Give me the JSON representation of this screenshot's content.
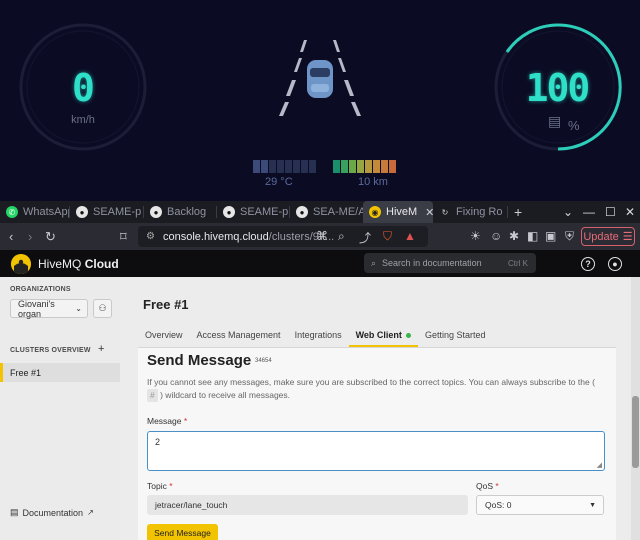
{
  "dashboard": {
    "speed": "0",
    "speed_unit": "km/h",
    "battery": "100",
    "battery_unit": "%",
    "temperature": "29 °C",
    "distance": "10 km",
    "colors": {
      "accent": "#2fe0c8",
      "background": "#0b0c24"
    }
  },
  "browser": {
    "tabs": [
      {
        "label": "WhatsApp",
        "icon": "whatsapp-icon"
      },
      {
        "label": "SEAME-p",
        "icon": "github-icon"
      },
      {
        "label": "Backlog",
        "icon": "github-icon"
      },
      {
        "label": "SEAME-p",
        "icon": "github-icon"
      },
      {
        "label": "SEA-ME/A",
        "icon": "github-icon"
      },
      {
        "label": "HiveM",
        "icon": "hivemq-icon",
        "active": true
      },
      {
        "label": "Fixing Ro",
        "icon": "refresh-icon"
      }
    ],
    "new_tab": "+",
    "url_host": "console.hivemq.cloud",
    "url_path": "/clusters/97...",
    "update_label": "Update"
  },
  "app": {
    "brand_name": "HiveMQ",
    "brand_suffix": "Cloud",
    "search_placeholder": "Search in documentation",
    "search_shortcut": "Ctrl K"
  },
  "sidebar": {
    "organizations_heading": "ORGANIZATIONS",
    "organization_value": "Giovani's organ",
    "clusters_heading": "CLUSTERS OVERVIEW",
    "cluster_items": [
      "Free #1"
    ],
    "documentation_label": "Documentation"
  },
  "main": {
    "cluster_title": "Free #1",
    "tabs": [
      {
        "label": "Overview"
      },
      {
        "label": "Access Management"
      },
      {
        "label": "Integrations"
      },
      {
        "label": "Web Client",
        "active": true
      },
      {
        "label": "Getting Started"
      }
    ],
    "send_message": {
      "title": "Send Message",
      "badge": "34654",
      "info_before": "If you cannot see any messages, make sure you are subscribed to the correct topics. You can always subscribe to the (",
      "info_code": "#",
      "info_after": ") wildcard to receive all messages.",
      "message_label": "Message",
      "message_value": "2",
      "topic_label": "Topic",
      "topic_value": "jetracer/lane_touch",
      "qos_label": "QoS",
      "qos_value": "QoS: 0",
      "required_mark": "*",
      "send_button": "Send Message"
    }
  }
}
